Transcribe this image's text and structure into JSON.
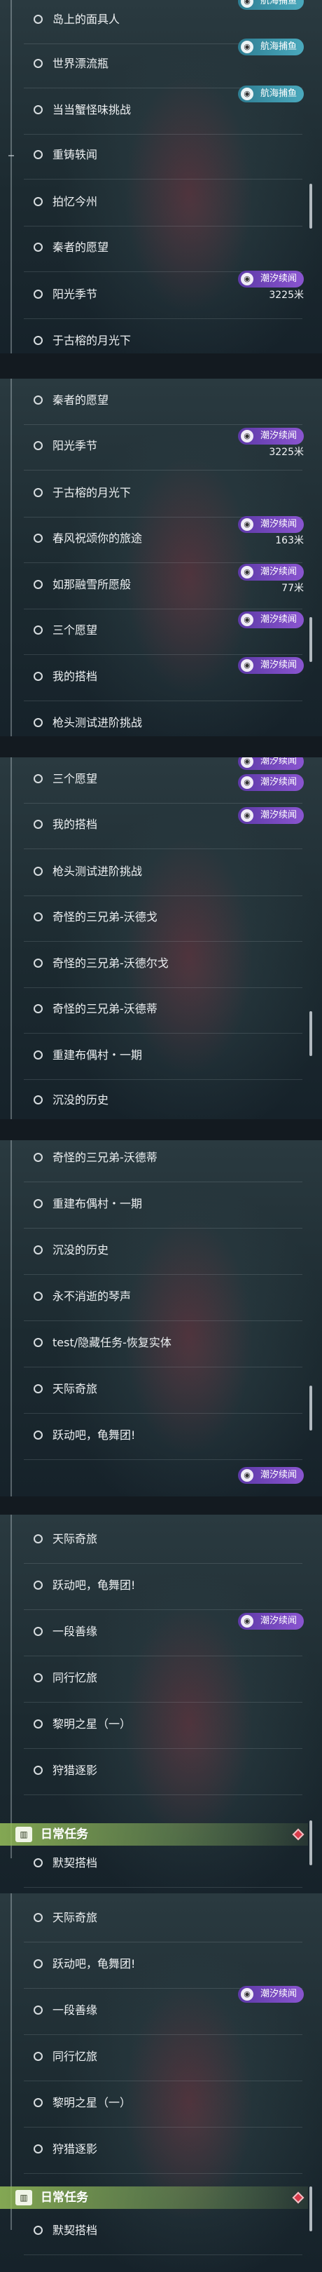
{
  "badges": {
    "hanghai": "航海捕鱼",
    "chaoxi": "潮汐续闻"
  },
  "dists": {
    "d3225": "3225米",
    "d163": "163米",
    "d77": "77米"
  },
  "quests": {
    "dao": "岛上的面具人",
    "piaoliu": "世界漂流瓶",
    "panxie": "当当蟹怪味挑战",
    "chongqi": "重铸轶闻",
    "paiyi": "拍忆今州",
    "qinzhe": "秦者的愿望",
    "yangguang": "阳光季节",
    "yuegu": "于古榕的月光下",
    "chunfeng": "春风祝颂你的旅途",
    "rumeng": "如那融雪所愿般",
    "sange": "三个愿望",
    "dadang": "我的搭档",
    "qiangtou": "枪头测试进阶挑战",
    "woqide": "奇怪的三兄弟-沃德戈",
    "woerge": "奇怪的三兄弟-沃德尔戈",
    "wodedi": "奇怪的三兄弟-沃德蒂",
    "chongjian": "重建布偶村・一期",
    "chenmo": "沉没的历史",
    "qinsheng": "永不消逝的琴声",
    "test": "test/隐藏任务-恢复实体",
    "tianji": "天际奇旅",
    "yuedong": "跃动吧，龟舞团!",
    "yiduan": "一段善缘",
    "tongxing": "同行忆旅",
    "liming": "黎明之星（一）",
    "shoulie": "狩猎逐影",
    "moqi": "默契搭档"
  },
  "daily": {
    "label": "日常任务",
    "icon": "quest-book-icon"
  },
  "icons": {
    "row": "circle-marker-icon",
    "badge": "tide-badge-icon",
    "marker": "red-diamond-icon"
  },
  "colors": {
    "purple_badge": "#7a4bc2",
    "teal_badge": "#3c93a8",
    "daily_header": "#9cc064",
    "diamond": "#d93b4a"
  }
}
